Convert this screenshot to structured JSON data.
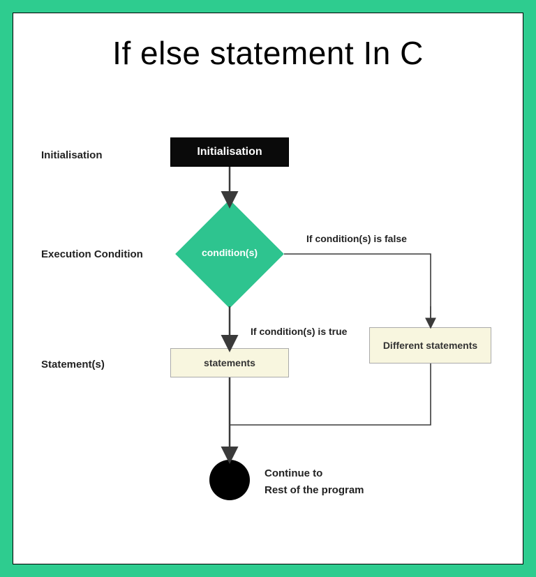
{
  "title": "If else statement In C",
  "labels": {
    "init": "Initialisation",
    "execCond": "Execution Condition",
    "statements": "Statement(s)"
  },
  "nodes": {
    "init": "Initialisation",
    "condition": "condition(s)",
    "trueStatements": "statements",
    "falseStatements": "Different statements"
  },
  "edges": {
    "trueLabel": "If condition(s) is true",
    "falseLabel": "If condition(s) is false"
  },
  "continue": {
    "line1": "Continue to",
    "line2": "Rest of the program"
  }
}
